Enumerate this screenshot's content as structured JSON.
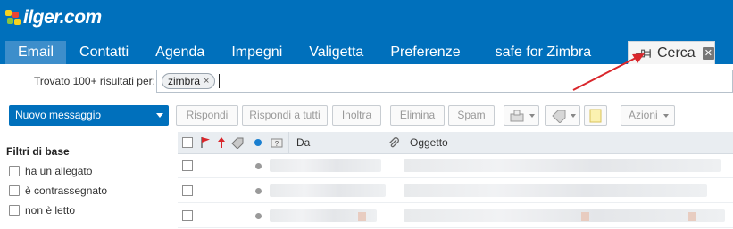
{
  "header": {
    "logo_text": "ilger.com"
  },
  "nav": {
    "tabs": [
      {
        "label": "Email",
        "active": true
      },
      {
        "label": "Contatti"
      },
      {
        "label": "Agenda"
      },
      {
        "label": "Impegni"
      },
      {
        "label": "Valigetta"
      },
      {
        "label": "Preferenze"
      },
      {
        "label": "safe for Zimbra"
      }
    ],
    "search_tab": {
      "label": "Cerca",
      "close_icon": "close-icon",
      "pin_icon": "pin-icon"
    }
  },
  "search": {
    "found_label": "Trovato 100+ risultati per:",
    "token": "zimbra",
    "token_remove": "×"
  },
  "toolbar": {
    "new_message": "Nuovo messaggio",
    "reply": "Rispondi",
    "reply_all": "Rispondi a tutti",
    "forward": "Inoltra",
    "delete": "Elimina",
    "spam": "Spam",
    "actions": "Azioni",
    "icons": [
      "move-folder-icon",
      "tag-icon",
      "note-icon"
    ]
  },
  "sidebar": {
    "title": "Filtri di base",
    "filters": [
      {
        "label": "ha un allegato"
      },
      {
        "label": "è contrassegnato"
      },
      {
        "label": "non è letto"
      }
    ]
  },
  "list": {
    "columns": {
      "from": "Da",
      "subject": "Oggetto"
    },
    "header_icons": [
      "select-all-checkbox",
      "flag-icon",
      "priority-icon",
      "tag-icon",
      "unread-dot-icon",
      "status-icon",
      "attachment-icon"
    ]
  },
  "colors": {
    "brand": "#0070bc",
    "active_tab": "#3d8ecb",
    "annotation_arrow": "#d9262b"
  }
}
